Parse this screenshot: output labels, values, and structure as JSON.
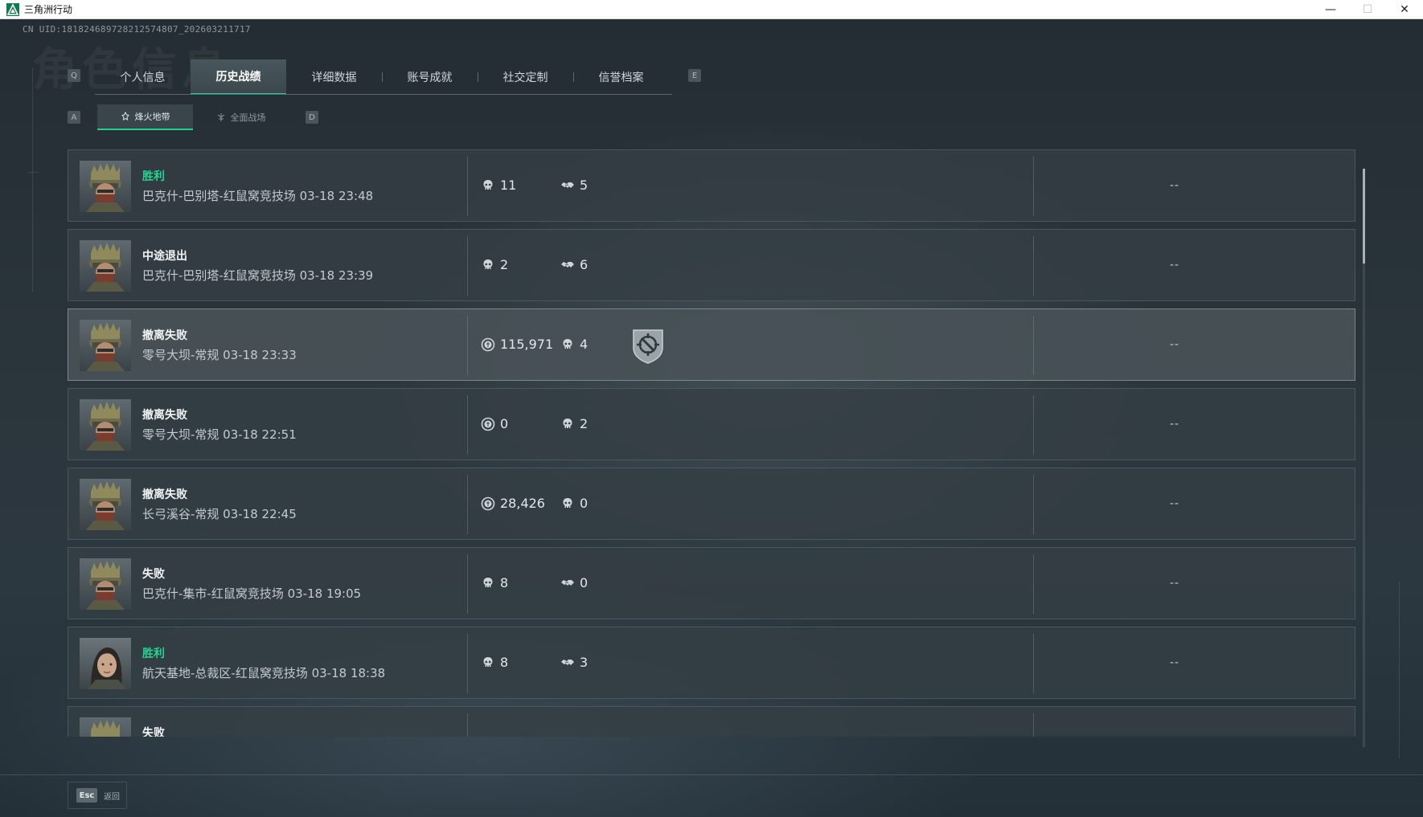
{
  "window": {
    "title": "三角洲行动",
    "minimize": "—",
    "maximize": "☐",
    "close": "✕"
  },
  "uid": "CN UID:181824689728212574807_202603211717",
  "watermark": "角色信息",
  "tab_keys": {
    "prev": "Q",
    "next": "E"
  },
  "tabs": [
    {
      "label": "个人信息"
    },
    {
      "label": "历史战绩"
    },
    {
      "label": "详细数据"
    },
    {
      "label": "账号成就"
    },
    {
      "label": "社交定制"
    },
    {
      "label": "信誉档案"
    }
  ],
  "subtab_keys": {
    "prev": "A",
    "next": "D"
  },
  "subtabs": [
    {
      "label": "烽火地带",
      "icon": "flame-zone-icon"
    },
    {
      "label": "全面战场",
      "icon": "battlefield-icon"
    }
  ],
  "accent_color": "#1fd18e",
  "matches": [
    {
      "result": "胜利",
      "win": true,
      "info": "巴克什-巴别塔-红鼠窝竞技场 03-18 23:48",
      "avatar": "operator-helmet",
      "stats": [
        {
          "icon": "skull-icon",
          "value": "11"
        },
        {
          "icon": "handshake-icon",
          "value": "5"
        }
      ],
      "score": "--"
    },
    {
      "result": "中途退出",
      "win": false,
      "info": "巴克什-巴别塔-红鼠窝竞技场 03-18 23:39",
      "avatar": "operator-helmet",
      "stats": [
        {
          "icon": "skull-icon",
          "value": "2"
        },
        {
          "icon": "handshake-icon",
          "value": "6"
        }
      ],
      "score": "--"
    },
    {
      "result": "撤离失败",
      "win": false,
      "info": "零号大坝-常规 03-18 23:33",
      "avatar": "operator-helmet",
      "stats": [
        {
          "icon": "coin-icon",
          "value": "115,971"
        },
        {
          "icon": "skull-icon",
          "value": "4"
        }
      ],
      "score": "--",
      "badge": "shield-target-badge-icon"
    },
    {
      "result": "撤离失败",
      "win": false,
      "info": "零号大坝-常规 03-18 22:51",
      "avatar": "operator-helmet",
      "stats": [
        {
          "icon": "coin-icon",
          "value": "0"
        },
        {
          "icon": "skull-icon",
          "value": "2"
        }
      ],
      "score": "--"
    },
    {
      "result": "撤离失败",
      "win": false,
      "info": "长弓溪谷-常规 03-18 22:45",
      "avatar": "operator-helmet",
      "stats": [
        {
          "icon": "coin-icon",
          "value": "28,426"
        },
        {
          "icon": "skull-icon",
          "value": "0"
        }
      ],
      "score": "--"
    },
    {
      "result": "失败",
      "win": false,
      "info": "巴克什-集市-红鼠窝竞技场 03-18 19:05",
      "avatar": "operator-helmet",
      "stats": [
        {
          "icon": "skull-icon",
          "value": "8"
        },
        {
          "icon": "handshake-icon",
          "value": "0"
        }
      ],
      "score": "--"
    },
    {
      "result": "胜利",
      "win": true,
      "info": "航天基地-总裁区-红鼠窝竞技场 03-18 18:38",
      "avatar": "operator-female",
      "stats": [
        {
          "icon": "skull-icon",
          "value": "8"
        },
        {
          "icon": "handshake-icon",
          "value": "3"
        }
      ],
      "score": "--"
    },
    {
      "result": "失败",
      "win": false,
      "info": "",
      "avatar": "operator-helmet",
      "stats": [],
      "score": ""
    }
  ],
  "footer": {
    "key": "Esc",
    "label": "返回"
  }
}
